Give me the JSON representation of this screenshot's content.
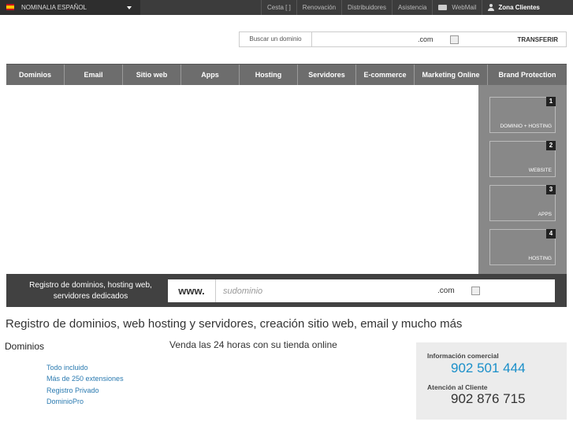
{
  "language": {
    "label": "NOMINALIA ESPAÑOL"
  },
  "top_links": [
    "Cesta [ ]",
    "Renovación",
    "Distribuidores",
    "Asistencia"
  ],
  "webmail": "WebMail",
  "zona_clientes": "Zona Clientes",
  "search": {
    "label": "Buscar un dominio",
    "tld": ".com",
    "transfer": "TRANSFERIR"
  },
  "nav": [
    {
      "label": "Dominios"
    },
    {
      "label": "Email"
    },
    {
      "label": "Sitio web"
    },
    {
      "label": "Apps"
    },
    {
      "label": "Hosting"
    },
    {
      "label": "Servidores"
    },
    {
      "label": "E-commerce"
    },
    {
      "label": "Marketing Online"
    },
    {
      "label": "Brand Protection"
    }
  ],
  "steps": [
    {
      "num": "1",
      "label": "DOMINIO + HOSTING"
    },
    {
      "num": "2",
      "label": "WEBSITE"
    },
    {
      "num": "3",
      "label": "APPS"
    },
    {
      "num": "4",
      "label": "HOSTING"
    }
  ],
  "domain_bar": {
    "text": "Registro de dominios, hosting web, servidores dedicados",
    "www": "www.",
    "placeholder": "sudominio",
    "tld": ".com"
  },
  "tagline": "Registro de dominios, web hosting y servidores, creación sitio web, email y mucho más",
  "dominios": {
    "title": "Dominios",
    "links": [
      "Todo incluido",
      "Más de 250 extensiones",
      "Registro Privado",
      "DominioPro"
    ]
  },
  "shop_text": "Venda las 24 horas con su tienda online",
  "contact": {
    "commercial_label": "Información comercial",
    "commercial_phone": "902 501 444",
    "support_label": "Atención al Cliente",
    "support_phone": "902 876 715"
  },
  "colors": {
    "accent_blue": "#1a8fc9",
    "nav_bg": "#6d6d6d",
    "topbar_bg": "#3c3c3c"
  }
}
